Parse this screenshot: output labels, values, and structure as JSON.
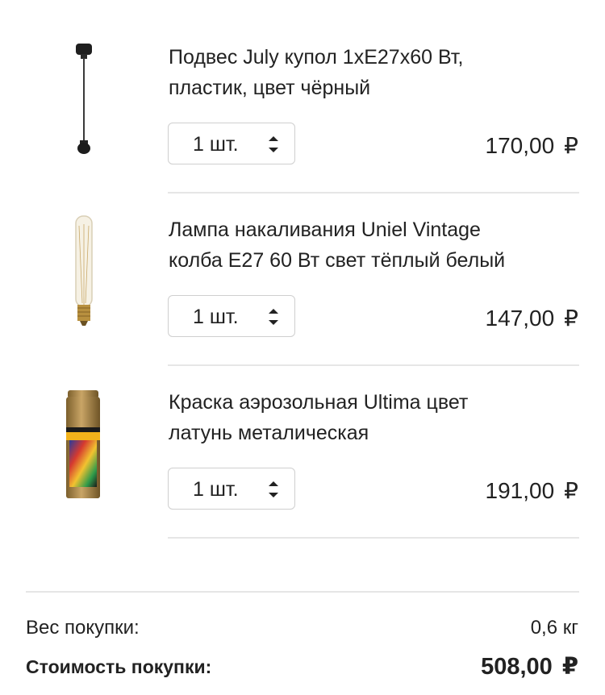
{
  "cart": {
    "items": [
      {
        "title_line1": "Подвес July купол 1хE27х60 Вт,",
        "title_line2": "пластик, цвет чёрный",
        "quantity": "1 шт.",
        "price": "170,00",
        "currency": "₽",
        "image_icon": "pendant-lamp-icon"
      },
      {
        "title_line1": "Лампа накаливания Uniel Vintage",
        "title_line2": "колба E27 60 Вт свет тёплый белый",
        "quantity": "1 шт.",
        "price": "147,00",
        "currency": "₽",
        "image_icon": "vintage-bulb-icon"
      },
      {
        "title_line1": "Краска аэрозольная Ultima цвет",
        "title_line2": "латунь металическая",
        "quantity": "1 шт.",
        "price": "191,00",
        "currency": "₽",
        "image_icon": "spray-can-icon"
      }
    ]
  },
  "summary": {
    "weight_label": "Вес покупки:",
    "weight_value": "0,6 кг",
    "total_label": "Стоимость покупки:",
    "total_value": "508,00",
    "currency": "₽"
  },
  "colors": {
    "text": "#222222",
    "divider": "#e6e6e6",
    "border": "#cfcfcf",
    "spray_gold": "#a98547"
  }
}
